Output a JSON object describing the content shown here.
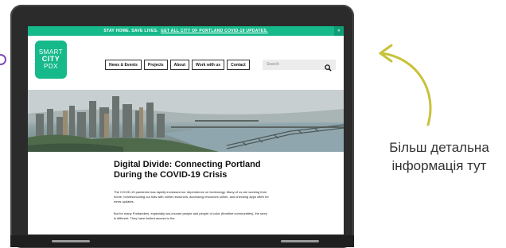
{
  "alert_bar": {
    "text": "STAY HOME. SAVE LIVES.",
    "link": "GET ALL CITY OF PORTLAND COVID-19 UPDATES.",
    "close": "×"
  },
  "logo": {
    "line1": "SMART",
    "line2": "CITY",
    "line3": "PDX"
  },
  "nav": {
    "items": [
      "News & Events",
      "Projects",
      "About",
      "Work with us",
      "Contact"
    ]
  },
  "search": {
    "placeholder": "Search"
  },
  "article": {
    "title": "Digital Divide: Connecting Portland During the COVID-19 Crisis",
    "para1": "The COVID-19 pandemic has rapidly increased our dependence on technology. Many of us are working from home, homeschooling our kids with online resources, accessing resources online, and checking apps often for news updates.",
    "para2_start": "But for many Portlanders, especially low-income people and people of color ",
    "para2_em": "(frontline communities)",
    "para2_end": ", the story is different. They have limited access to the"
  },
  "caption": "Більш детальна інформація тут",
  "colors": {
    "accent": "#16b98a",
    "arrow": "#c8c23a",
    "frame": "#2b2b2b"
  },
  "icons": {
    "search": "search-icon",
    "arrow": "curved-arrow-icon"
  }
}
